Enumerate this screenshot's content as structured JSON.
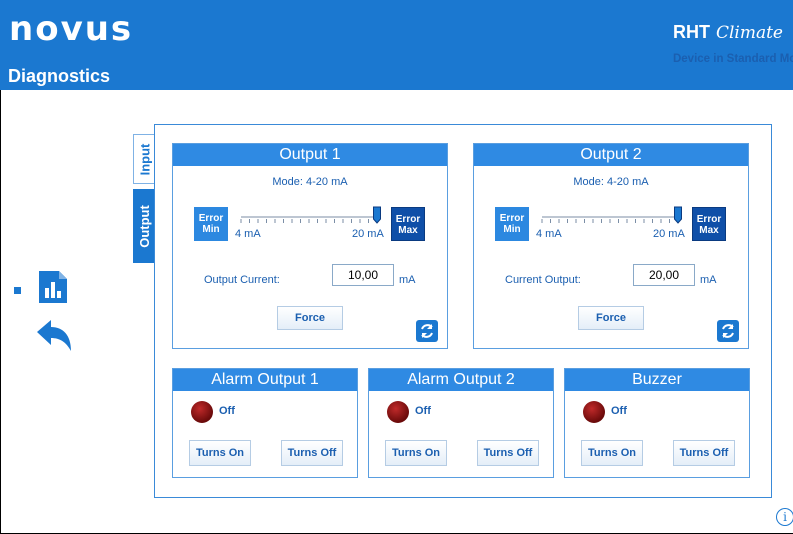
{
  "header": {
    "logo": "novus",
    "page_title": "Diagnostics",
    "product_name": "RHT",
    "product_script": "Climate",
    "device_mode": "Device in Standard Mode"
  },
  "tabs": [
    "Input",
    "Output"
  ],
  "output1": {
    "title": "Output 1",
    "mode": "Mode: 4-20 mA",
    "error_min": [
      "Error",
      "Min"
    ],
    "error_max": [
      "Error",
      "Max"
    ],
    "range_min": "4 mA",
    "range_max": "20 mA",
    "slider_level": 1.0,
    "field_label": "Output Current:",
    "value": "10,00",
    "unit": "mA",
    "force": "Force"
  },
  "output2": {
    "title": "Output 2",
    "mode": "Mode: 4-20 mA",
    "error_min": [
      "Error",
      "Min"
    ],
    "error_max": [
      "Error",
      "Max"
    ],
    "range_min": "4 mA",
    "range_max": "20 mA",
    "slider_level": 1.0,
    "field_label": "Current Output:",
    "value": "20,00",
    "unit": "mA",
    "force": "Force"
  },
  "alarm1": {
    "title": "Alarm Output 1",
    "state": "Off",
    "on": "Turns On",
    "off": "Turns Off"
  },
  "alarm2": {
    "title": "Alarm Output 2",
    "state": "Off",
    "on": "Turns On",
    "off": "Turns Off"
  },
  "buzzer": {
    "title": "Buzzer",
    "state": "Off",
    "on": "Turns On",
    "off": "Turns Off"
  },
  "colors": {
    "accent": "#1b78d0",
    "led_off": "#8b0f0f"
  }
}
